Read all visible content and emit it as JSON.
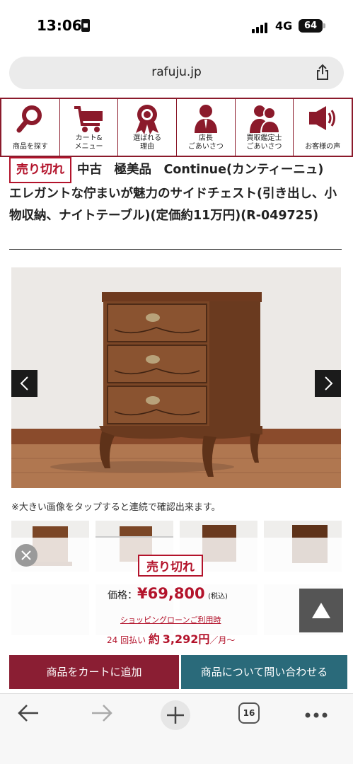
{
  "status_bar": {
    "time": "13:06",
    "network": "4G",
    "battery": "64"
  },
  "browser": {
    "url": "rafuju.jp",
    "tab_count": "16"
  },
  "nav": [
    {
      "label": "商品を探す",
      "icon": "search-icon"
    },
    {
      "label": "カート&\nメニュー",
      "icon": "cart-icon"
    },
    {
      "label": "選ばれる\n理由",
      "icon": "medal-icon"
    },
    {
      "label": "店長\nごあいさつ",
      "icon": "person-icon"
    },
    {
      "label": "買取鑑定士\nごあいさつ",
      "icon": "people-icon"
    },
    {
      "label": "お客様の声",
      "icon": "megaphone-icon"
    }
  ],
  "product": {
    "sold_badge": "売り切れ",
    "title": "中古　極美品　Continue(カンティーニュ)　エレガントな佇まいが魅力のサイドチェスト(引き出し、小物収納、ナイトテーブル)(定価約11万円)(R-049725)",
    "image_note": "※大きい画像をタップすると連続で確認出来ます。"
  },
  "purchase": {
    "sold_badge": "売り切れ",
    "price_label": "価格：",
    "price": "¥69,800",
    "tax_note": "(税込)",
    "loan_link": "ショッピングローンご利用時",
    "installment_count": "24 回払い",
    "installment_prefix": "約",
    "installment_amount": "3,292円",
    "installment_suffix": "／月～"
  },
  "buttons": {
    "add_to_cart": "商品をカートに追加",
    "inquiry": "商品について問い合わせる"
  },
  "colors": {
    "brand": "#8a1e33",
    "accent_red": "#b3132b",
    "teal": "#2a6a7a"
  }
}
